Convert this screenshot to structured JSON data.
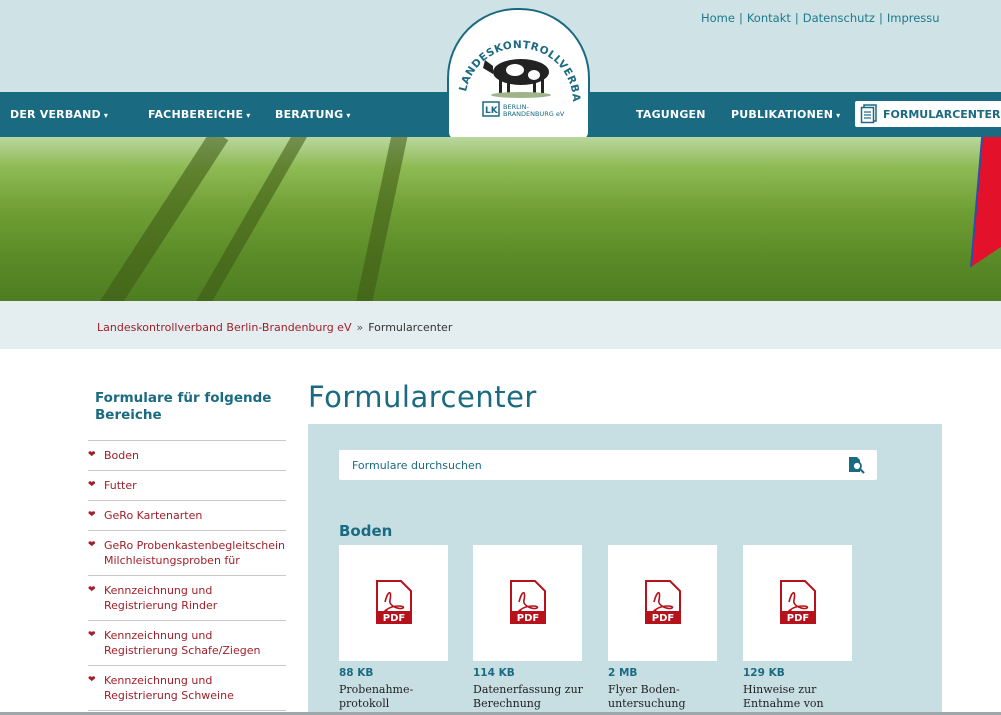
{
  "header": {
    "top_links": [
      "Home",
      "Kontakt",
      "Datenschutz",
      "Impressu"
    ],
    "logo": {
      "arc_text": "LANDESKONTROLLVERBAND",
      "sub_line1": "BERLIN-",
      "sub_line2": "BRANDENBURG eV"
    }
  },
  "nav": {
    "left": [
      {
        "label": "DER VERBAND",
        "has_dropdown": true
      },
      {
        "label": "FACHBEREICHE",
        "has_dropdown": true
      },
      {
        "label": "BERATUNG",
        "has_dropdown": true
      }
    ],
    "right": [
      {
        "label": "TAGUNGEN",
        "has_dropdown": false
      },
      {
        "label": "PUBLIKATIONEN",
        "has_dropdown": true
      }
    ],
    "active": {
      "label": "FORMULARCENTER",
      "icon": "document-icon"
    },
    "caret_glyph": "▾"
  },
  "breadcrumb": {
    "home": "Landeskontrollverband Berlin-Brandenburg eV",
    "separator": "»",
    "current": "Formularcenter"
  },
  "sidebar": {
    "title": "Formulare für folgende Bereiche",
    "items": [
      "Boden",
      "Futter",
      "GeRo Kartenarten",
      "GeRo Probenkastenbegleitschein Milchleistungsproben für",
      "Kennzeichnung und Registrierung Rinder",
      "Kennzeichnung und Registrierung Schafe/Ziegen",
      "Kennzeichnung und Registrierung Schweine"
    ],
    "bullet_glyph": "❤"
  },
  "main": {
    "title": "Formularcenter",
    "search": {
      "placeholder": "Formulare durchsuchen"
    },
    "section": "Boden",
    "cards": [
      {
        "size": "88 KB",
        "name": "Probenahme-protokoll"
      },
      {
        "size": "114 KB",
        "name": "Datenerfassung zur Berechnung"
      },
      {
        "size": "2 MB",
        "name": "Flyer Boden-untersuchung"
      },
      {
        "size": "129 KB",
        "name": "Hinweise zur Entnahme von"
      }
    ],
    "pdf_label": "PDF"
  },
  "colors": {
    "brand_teal": "#1a6b82",
    "link_red": "#a0202a",
    "pdf_red": "#b5121b",
    "panel_bg": "#c7dfe3",
    "header_bg": "#cfe2e6"
  }
}
